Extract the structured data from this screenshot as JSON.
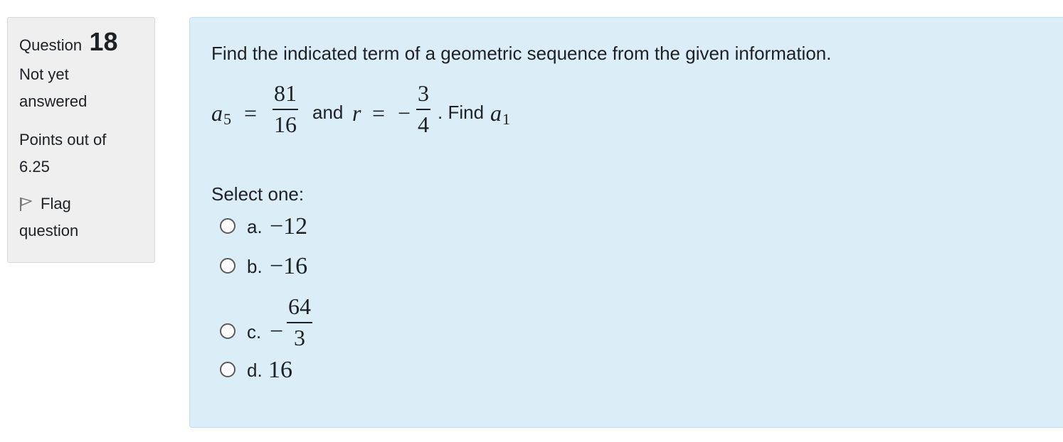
{
  "question_info": {
    "question_word": "Question",
    "question_number": "18",
    "state_line1": "Not yet",
    "state_line2": "answered",
    "grade_line1": "Points out of",
    "grade_line2": "6.25",
    "flag_line1": "Flag",
    "flag_line2": "question",
    "flag_icon": "flag-icon"
  },
  "question": {
    "prompt": "Find the indicated term of a geometric sequence from the given information.",
    "math": {
      "a5_var": "a",
      "a5_sub": "5",
      "equals": "=",
      "a5_num": "81",
      "a5_den": "16",
      "and_text": "and",
      "r_var": "r",
      "r_equals": "=",
      "r_sign": "−",
      "r_num": "3",
      "r_den": "4",
      "find_text": ". Find",
      "a1_var": "a",
      "a1_sub": "1"
    },
    "select_label": "Select one:",
    "options": [
      {
        "letter": "a.",
        "value": "−12"
      },
      {
        "letter": "b.",
        "value": "−16"
      },
      {
        "letter": "c.",
        "sign": "−",
        "num": "64",
        "den": "3"
      },
      {
        "letter": "d.",
        "value": "16"
      }
    ]
  },
  "colors": {
    "info_bg": "#efefef",
    "content_bg": "#dbeef7",
    "content_border": "#bde0ef",
    "text": "#1d2125"
  }
}
